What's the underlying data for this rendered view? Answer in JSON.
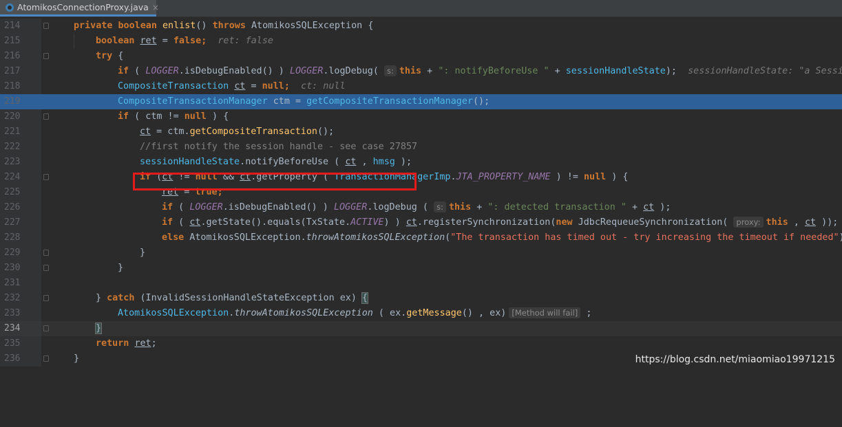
{
  "tab": {
    "filename": "AtomikosConnectionProxy.java",
    "close": "×"
  },
  "gutter": {
    "line_numbers": [
      "214",
      "215",
      "216",
      "217",
      "218",
      "219",
      "220",
      "221",
      "222",
      "223",
      "224",
      "225",
      "226",
      "227",
      "228",
      "229",
      "230",
      "231",
      "232",
      "233",
      "234",
      "235",
      "236"
    ],
    "current_line": "234",
    "execution_line": "219"
  },
  "code": {
    "l214": {
      "kw1": "private",
      "kw2": "boolean",
      "name": "enlist",
      "punct1": "() ",
      "kw3": "throws",
      "type": " AtomikosSQLException ",
      "brace": "{"
    },
    "l215": {
      "kw": "boolean",
      "var": "ret",
      "eq": " = ",
      "val": "false",
      "semi": ";",
      "hint": "ret: false"
    },
    "l216": {
      "kw": "try",
      "brace": " {"
    },
    "l217": {
      "kw": "if",
      "p1": " ( ",
      "field1": "LOGGER",
      "m1": ".isDebugEnabled() ) ",
      "field2": "LOGGER",
      "m2": ".logDebug( ",
      "param": "s:",
      "kw2": "this",
      "plus1": " + ",
      "str": "\": notifyBeforeUse \"",
      "plus2": " + ",
      "ref": "sessionHandleState",
      "end": ");",
      "hint": "sessionHandleState: \"a Sessi"
    },
    "l218": {
      "type": "CompositeTransaction",
      "var": "ct",
      "eq": " = ",
      "val": "null",
      "semi": ";",
      "hint": "ct: null"
    },
    "l219": {
      "type": "CompositeTransactionManager",
      "rest": " ctm = ",
      "call": "getCompositeTransactionManager",
      "end": "();"
    },
    "l220": {
      "kw": "if",
      "p1": " ( ctm != ",
      "val": "null",
      "p2": " ) {"
    },
    "l221": {
      "var": "ct",
      "rest": " = ctm.",
      "call": "getCompositeTransaction",
      "end": "();"
    },
    "l222": {
      "comment": "//first notify the session handle - see case 27857"
    },
    "l223": {
      "ref": "sessionHandleState",
      "dot": ".",
      "call": "notifyBeforeUse",
      "p1": " ( ",
      "var": "ct",
      "comma": " , ",
      "ref2": "hmsg",
      "end": " );"
    },
    "l224": {
      "kw": "if",
      "p1": " (",
      "var1": "ct",
      "p2": " != ",
      "val": "null",
      "p3": " && ",
      "var2": "ct",
      "m1": ".getProperty ( ",
      "type": "TransactionManagerImp",
      "dot": ".",
      "const": "JTA_PROPERTY_NAME",
      "p4": " ) != ",
      "val2": "null",
      "end": " ) {"
    },
    "l225": {
      "var": "ret",
      "eq": " = ",
      "val": "true",
      "semi": ";"
    },
    "l226": {
      "kw": "if",
      "p1": " ( ",
      "field1": "LOGGER",
      "m1": ".isDebugEnabled() ) ",
      "field2": "LOGGER",
      "m2": ".logDebug ( ",
      "param": "s:",
      "kw2": "this",
      "plus1": " + ",
      "str": "\": detected transaction \"",
      "plus2": " + ",
      "var": "ct",
      "end": " );"
    },
    "l227": {
      "kw": "if",
      "p1": " ( ",
      "var1": "ct",
      "m1": ".getState().equals(",
      "type": "TxState",
      "dot": ".",
      "const": "ACTIVE",
      "p2": ") ) ",
      "var2": "ct",
      "m2": ".registerSynchronization(",
      "kw2": "new",
      "type2": " JdbcRequeueSynchronization( ",
      "param": "proxy:",
      "kw3": "this",
      "comma": " , ",
      "var3": "ct",
      "end": " ));"
    },
    "l228": {
      "kw": "else",
      "type": " AtomikosSQLException",
      "dot": ".",
      "call": "throwAtomikosSQLException",
      "p1": "(",
      "str": "\"The transaction has timed out - try increasing the timeout if needed\"",
      "end": ")"
    },
    "l229": {
      "brace": "}"
    },
    "l230": {
      "brace": "}"
    },
    "l231": {
      "blank": ""
    },
    "l232": {
      "brace": "} ",
      "kw": "catch",
      "rest": " (InvalidSessionHandleStateException ex) ",
      "brace2": "{"
    },
    "l233": {
      "type": "AtomikosSQLException",
      "dot": ".",
      "call": "throwAtomikosSQLException",
      "p1": " ( ex.",
      "m": "getMessage",
      "p2": "() , ex)",
      "warn": "[Method will fail]",
      "end": " ;"
    },
    "l234": {
      "brace": "}"
    },
    "l235": {
      "kw": "return",
      "var": "ret",
      "semi": ";"
    },
    "l236": {
      "brace": "}"
    }
  },
  "watermark": "https://blog.csdn.net/miaomiao19971215",
  "colors": {
    "keyword": "#cc7832",
    "string": "#6a8759",
    "field": "#9876aa",
    "comment": "#808080",
    "exec_line": "#2d6099",
    "highlight_box": "#e31b1b"
  },
  "icons": {
    "file": "java-class-icon",
    "fold": "fold-marker-icon"
  }
}
